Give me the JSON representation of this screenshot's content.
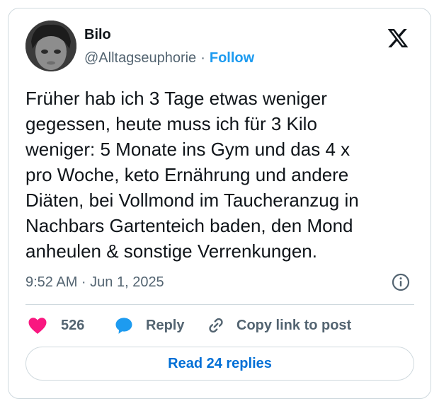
{
  "author": {
    "name": "Bilo",
    "handle": "@Alltagseuphorie",
    "separator": "·",
    "follow_label": "Follow"
  },
  "tweet": {
    "text": "Früher hab ich 3 Tage etwas weniger\ngegessen, heute muss ich für 3 Kilo\nweniger: 5 Monate ins Gym und das 4 x\npro Woche, keto Ernährung und andere\nDiäten, bei Vollmond im Taucheranzug in\nNachbars Gartenteich baden, den Mond\nanheulen & sonstige Verrenkungen.",
    "timestamp": "9:52 AM · Jun 1, 2025"
  },
  "actions": {
    "like_count": "526",
    "reply_label": "Reply",
    "copy_link_label": "Copy link to post"
  },
  "read_replies_label": "Read 24 replies",
  "icons": {
    "brand": "x-logo-icon",
    "info": "info-icon",
    "like": "heart-icon",
    "reply": "speech-bubble-icon",
    "copy": "link-icon"
  },
  "colors": {
    "text": "#0f1419",
    "secondary": "#536471",
    "follow": "#1d9bf0",
    "link_button": "#006fd6",
    "like": "#f91880",
    "reply": "#1d9bf0",
    "border": "#cfd9de"
  }
}
